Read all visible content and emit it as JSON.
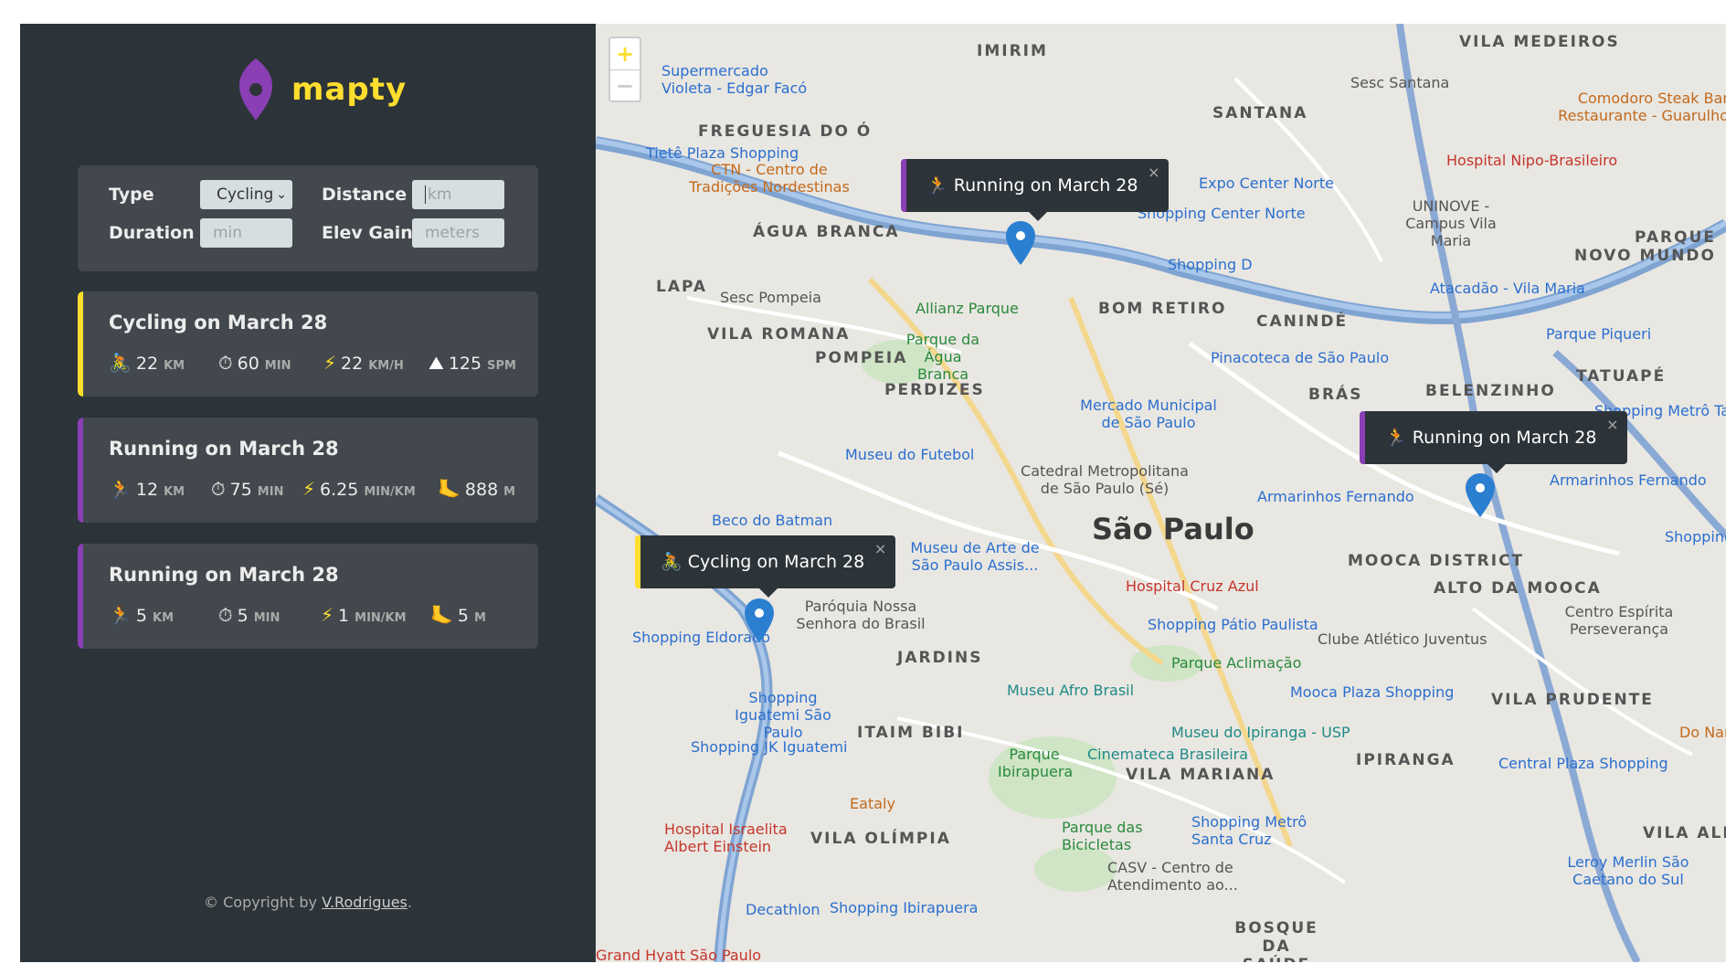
{
  "app": {
    "name": "mapty"
  },
  "form": {
    "type_label": "Type",
    "type_value": "Cycling",
    "distance_label": "Distance",
    "distance_placeholder": "km",
    "duration_label": "Duration",
    "duration_placeholder": "min",
    "elev_label": "Elev Gain",
    "elev_placeholder": "meters"
  },
  "workouts": [
    {
      "title": "Cycling on March 28",
      "kind": "cycling",
      "distance": "22",
      "distance_unit": "KM",
      "duration": "60",
      "duration_unit": "MIN",
      "speed": "22",
      "speed_unit": "KM/H",
      "extra": "125",
      "extra_unit": "SPM"
    },
    {
      "title": "Running on March 28",
      "kind": "running",
      "distance": "12",
      "distance_unit": "KM",
      "duration": "75",
      "duration_unit": "MIN",
      "speed": "6.25",
      "speed_unit": "MIN/KM",
      "extra": "888",
      "extra_unit": "M"
    },
    {
      "title": "Running on March 28",
      "kind": "running",
      "distance": "5",
      "distance_unit": "KM",
      "duration": "5",
      "duration_unit": "MIN",
      "speed": "1",
      "speed_unit": "MIN/KM",
      "extra": "5",
      "extra_unit": "M"
    }
  ],
  "footer": {
    "prefix": "© Copyright by ",
    "author": "V.Rodrigues",
    "suffix": "."
  },
  "map": {
    "zoom_in": "+",
    "zoom_out": "−",
    "popups": [
      {
        "text": "Running on March 28",
        "emoji": "🏃"
      },
      {
        "text": "Running on March 28",
        "emoji": "🏃"
      },
      {
        "text": "Cycling on March 28",
        "emoji": "🚴"
      }
    ],
    "city": "São Paulo",
    "districts": [
      "IMIRIM",
      "VILA MEDEIROS",
      "SANTANA",
      "FREGUESIA DO Ó",
      "ÁGUA BRANCA",
      "LAPA",
      "VILA ROMANA",
      "POMPEIA",
      "PERDIZES",
      "BOM RETIRO",
      "CANINDÉ",
      "BRÁS",
      "BELENZINHO",
      "TATUAPÉ",
      "PARQUE NOVO MUNDO",
      "MOOCA DISTRICT",
      "ALTO DA MOOCA",
      "JARDINS",
      "ITAIM BIBI",
      "VILA MARIANA",
      "IPIRANGA",
      "VILA PRUDENTE",
      "VILA OLÍMPIA",
      "BOSQUE DA SAÚDE",
      "VILA ALPI"
    ],
    "places_blue": [
      "Supermercado Violeta - Edgar Facó",
      "Tietê Plaza Shopping",
      "Expo Center Norte",
      "Shopping Center Norte",
      "Shopping D",
      "Atacadão - Vila Maria",
      "Pinacoteca de São Paulo",
      "Mercado Municipal de São Paulo",
      "Museu do Futebol",
      "Armarinhos Fernando",
      "Armarinhos Fernando",
      "Shopping Metrô Ta",
      "Beco do Batman",
      "Museu de Arte de São Paulo Assis...",
      "Shopping Eldorado",
      "Shopping Iguatemi São Paulo",
      "Shopping JK Iguatemi",
      "Shopping Pátio Paulista",
      "Mooca Plaza Shopping",
      "Central Plaza Shopping",
      "Shopping Metrô Santa Cruz",
      "Decathlon",
      "Shopping Ibirapuera",
      "Leroy Merlin São Caetano do Sul",
      "Shopping",
      "Sesc Santana",
      "Sesc Pompeia",
      "Museu Afro Brasil",
      "Museu do Ipiranga - USP",
      "Cinemateca Brasileira"
    ],
    "places_red": [
      "Hospital Nipo-Brasileiro",
      "Hospital Cruz Azul",
      "Hospital Israelita Albert Einstein",
      "Comodoro Steak Bar Restaurante - Guarulho",
      "CTN - Centro de Tradições Nordestinas",
      "Eataly",
      "Do Nan"
    ],
    "places_green": [
      "Allianz Parque",
      "Parque da Água Branca",
      "Parque Aclimação",
      "Parque Ibirapuera",
      "Parque das Bicicletas"
    ],
    "places_gray": [
      "UNINOVE - Campus Vila Maria",
      "Parque Piqueri",
      "Catedral Metropolitana de São Paulo (Sé)",
      "Paróquia Nossa Senhora do Brasil",
      "Clube Atlético Juventus",
      "Centro Espírita Perseverança",
      "CASV - Centro de Atendimento ao...",
      "Grand Hyatt São Paulo"
    ]
  }
}
